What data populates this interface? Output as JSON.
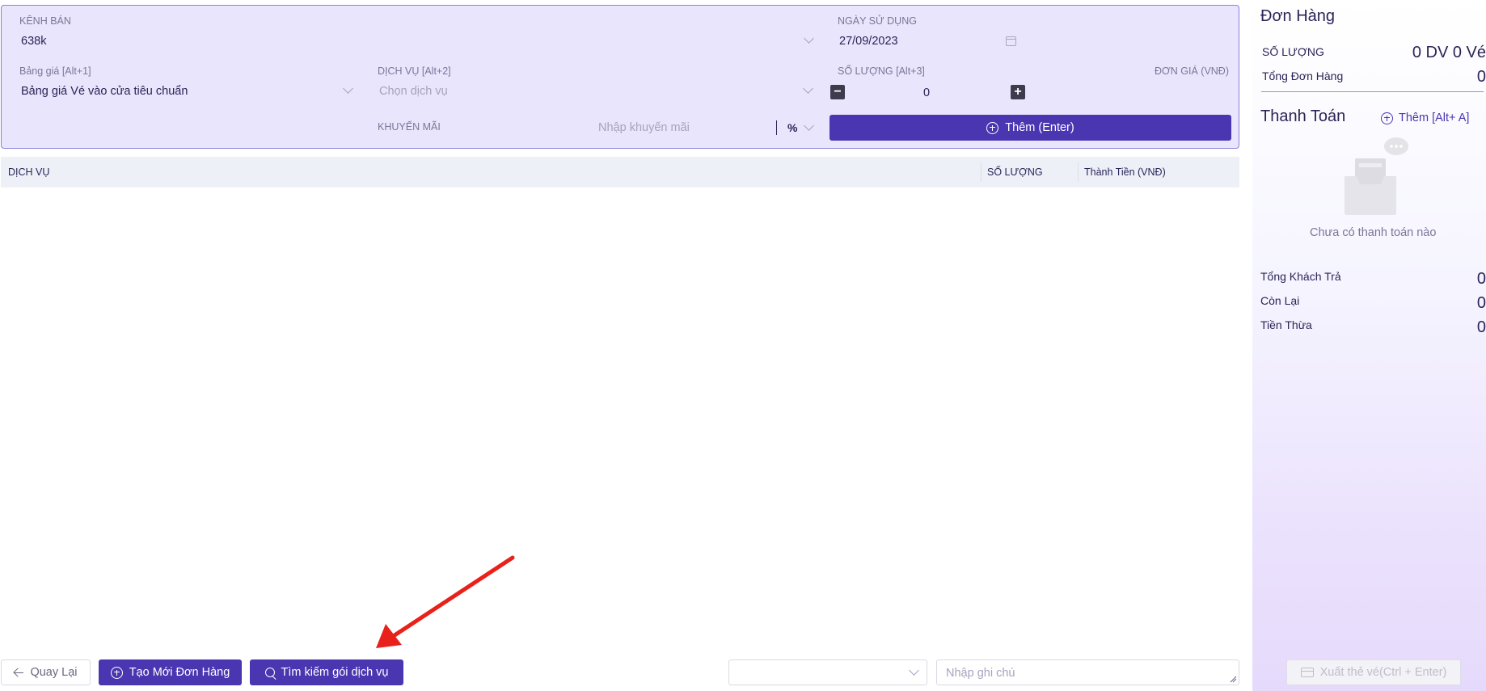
{
  "form": {
    "channel": {
      "label": "KÊNH BÁN",
      "value": "638k"
    },
    "date": {
      "label": "NGÀY SỬ DỤNG",
      "value": "27/09/2023"
    },
    "price_list": {
      "label": "Bảng giá [Alt+1]",
      "value": "Bảng giá Vé vào cửa tiêu chuẩn"
    },
    "service": {
      "label": "DỊCH VỤ [Alt+2]",
      "placeholder": "Chọn dịch vụ"
    },
    "quantity": {
      "label": "SỐ LƯỢNG [Alt+3]",
      "value": "0"
    },
    "unit_price": {
      "label": "ĐƠN GIÁ (VNĐ)"
    },
    "promotion": {
      "label": "KHUYẾN MÃI",
      "placeholder": "Nhập khuyến mãi",
      "unit": "%"
    },
    "add_button": "Thêm (Enter)"
  },
  "table": {
    "columns": [
      "DỊCH VỤ",
      "SỐ LƯỢNG",
      "Thành Tiền (VNĐ)"
    ],
    "rows": []
  },
  "bottom": {
    "back_button": "Quay Lại",
    "new_order_button": "Tạo Mới Đơn Hàng",
    "search_button": "Tìm kiếm gói dịch vụ",
    "select_value": "",
    "note_placeholder": "Nhập ghi chú"
  },
  "sidebar": {
    "order_title": "Đơn Hàng",
    "quantity_label": "SỐ LƯỢNG",
    "quantity_value": "0 DV 0 Vé",
    "total_order_label": "Tổng Đơn Hàng",
    "total_order_value": "0",
    "payment_title": "Thanh Toán",
    "add_payment": "Thêm [Alt+ A]",
    "empty_payment": "Chưa có thanh toán nào",
    "customer_paid_label": "Tổng Khách Trả",
    "customer_paid_value": "0",
    "remaining_label": "Còn Lại",
    "remaining_value": "0",
    "change_label": "Tiền Thừa",
    "change_value": "0",
    "export_button": "Xuất thẻ vé(Ctrl + Enter)"
  },
  "colors": {
    "primary": "#4a36b0",
    "panel_bg": "#e9e5fc",
    "panel_border": "#8c7fe0",
    "annotation_arrow": "#e8221b"
  }
}
